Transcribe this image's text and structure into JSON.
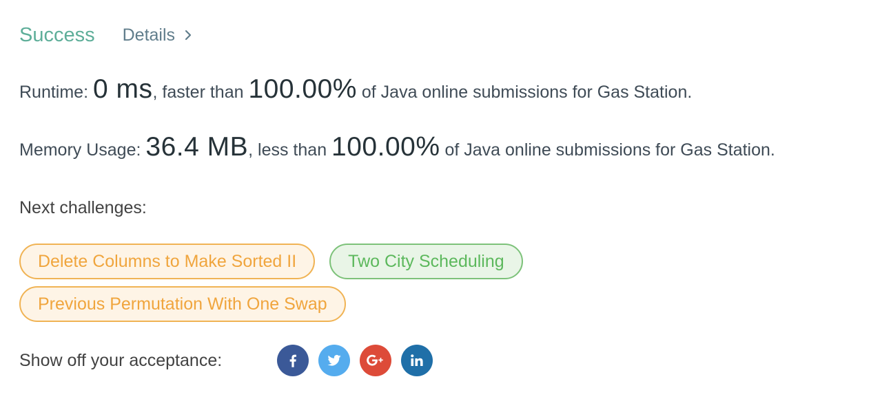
{
  "result": {
    "status": "Success",
    "details_label": "Details",
    "status_color": "#5eae99"
  },
  "runtime": {
    "label": "Runtime: ",
    "value": "0 ms",
    "comparison": ", faster than ",
    "percent": "100.00%",
    "suffix": " of Java online submissions for Gas Station."
  },
  "memory": {
    "label": "Memory Usage: ",
    "value": "36.4 MB",
    "comparison": ", less than ",
    "percent": "100.00%",
    "suffix": " of Java online submissions for Gas Station."
  },
  "next": {
    "label": "Next challenges:",
    "challenges": [
      {
        "title": "Delete Columns to Make Sorted II",
        "difficulty_color": "#f0a53d"
      },
      {
        "title": "Two City Scheduling",
        "difficulty_color": "#5cb85c"
      },
      {
        "title": "Previous Permutation With One Swap",
        "difficulty_color": "#f0a53d"
      }
    ]
  },
  "share": {
    "label": "Show off your acceptance:",
    "networks": [
      {
        "icon": "facebook-icon",
        "color": "#3b5998"
      },
      {
        "icon": "twitter-icon",
        "color": "#55acee"
      },
      {
        "icon": "google-plus-icon",
        "color": "#dd4b39"
      },
      {
        "icon": "linkedin-icon",
        "color": "#1f6fa8"
      }
    ]
  }
}
